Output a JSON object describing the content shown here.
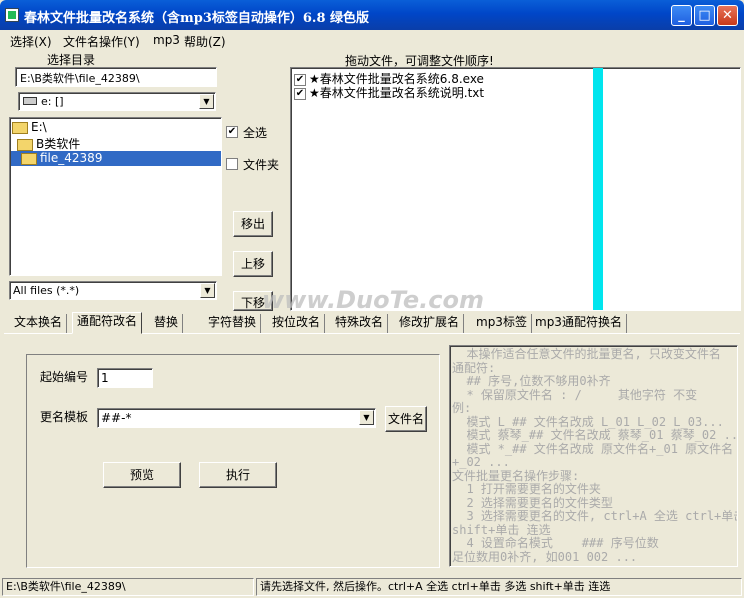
{
  "window": {
    "title": "春林文件批量改名系统（含mp3标签自动操作）6.8 绿色版"
  },
  "menu": [
    "选择(X)",
    "文件名操作(Y)",
    "mp3",
    "帮助(Z)"
  ],
  "left": {
    "header": "选择目录",
    "path": "E:\\B类软件\\file_42389\\",
    "drive": "e: []",
    "tree": [
      "E:\\",
      "B类软件",
      "file_42389"
    ],
    "filter": "All files (*.*)"
  },
  "middle": {
    "select_all": "全选",
    "folder": "文件夹",
    "remove": "移出",
    "up": "上移",
    "down": "下移"
  },
  "right": {
    "header": "拖动文件，可调整文件顺序!",
    "files": [
      "★春林文件批量改名系统6.8.exe",
      "★春林文件批量改名系统说明.txt"
    ]
  },
  "tabs": [
    "文本换名",
    "通配符改名",
    "替换",
    "字符替换",
    "按位改名",
    "特殊改名",
    "修改扩展名",
    "mp3标签",
    "mp3通配符换名"
  ],
  "form": {
    "start_label": "起始编号",
    "start_value": "1",
    "template_label": "更名模板",
    "template_value": "##-*",
    "filename_btn": "文件名",
    "preview_btn": "预览",
    "execute_btn": "执行"
  },
  "help_text": "  本操作适合任意文件的批量更名, 只改变文件名\n通配符:\n  ## 序号,位数不够用0补齐\n  * 保留原文件名 : /     其他字符 不变\n例:\n  模式 L_## 文件名改成 L_01 L_02 L_03...\n  模式 蔡琴_## 文件名改成 蔡琴_01 蔡琴_02 ...\n  模式 *_## 文件名改成 原文件名+_01 原文件名\n+_02 ...\n文件批量更名操作步骤:\n  1 打开需要更名的文件夹\n  2 选择需要更名的文件类型\n  3 选择需要更名的文件, ctrl+A 全选 ctrl+单击\nshift+单击 连选\n  4 设置命名模式    ### 序号位数\n足位数用0补齐, 如001 002 ...",
  "status": {
    "path": "E:\\B类软件\\file_42389\\",
    "hint": "请先选择文件, 然后操作。ctrl+A 全选 ctrl+单击 多选 shift+单击 连选"
  },
  "watermark": "www.DuoTe.com",
  "colors": {
    "titlebar": "#0a5fd8",
    "selection": "#316ac5",
    "cyan_bar": "#00e5ee",
    "face": "#ece9d8"
  }
}
